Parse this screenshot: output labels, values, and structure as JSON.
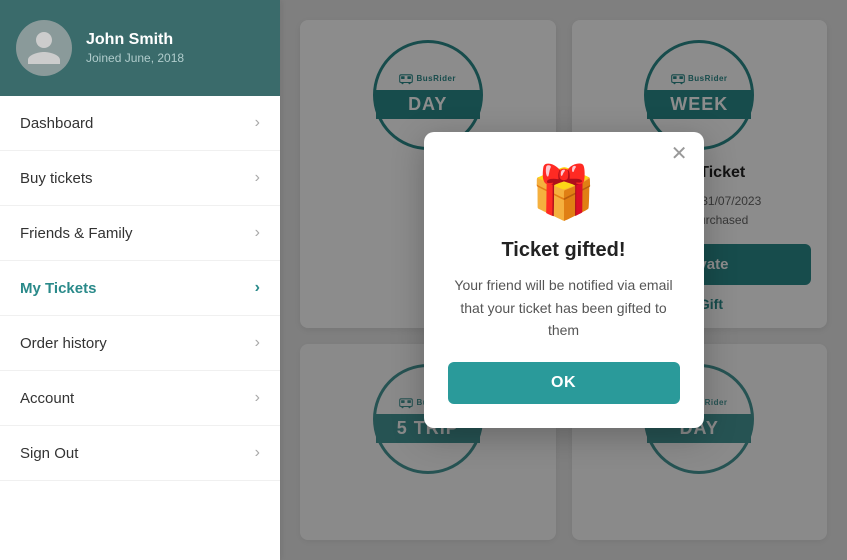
{
  "sidebar": {
    "user": {
      "name": "John Smith",
      "joined": "Joined June, 2018"
    },
    "nav_items": [
      {
        "label": "Dashboard",
        "active": false
      },
      {
        "label": "Buy tickets",
        "active": false
      },
      {
        "label": "Friends & Family",
        "active": false
      },
      {
        "label": "My Tickets",
        "active": true
      },
      {
        "label": "Order history",
        "active": false
      },
      {
        "label": "Account",
        "active": false
      },
      {
        "label": "Sign Out",
        "active": false
      }
    ]
  },
  "tickets": [
    {
      "id": "day-1",
      "type": "DAY",
      "title": "",
      "purchased": "",
      "status": ""
    },
    {
      "id": "week-1",
      "type": "WEEK",
      "title": "Week Ticket",
      "purchased": "Purchased: 31/07/2023",
      "status": "Status: Purchased",
      "activate_label": "Activate",
      "gift_label": "Gift"
    },
    {
      "id": "5trip-1",
      "type": "5 TRIP",
      "title": "",
      "purchased": "",
      "status": ""
    },
    {
      "id": "day-2",
      "type": "DAY",
      "title": "",
      "purchased": "",
      "status": ""
    }
  ],
  "modal": {
    "title": "Ticket gifted!",
    "body": "Your friend will be notified via email that your ticket has been gifted to them",
    "ok_label": "OK",
    "icon": "🎁"
  },
  "brand": {
    "name": "BusRider"
  },
  "colors": {
    "teal": "#2a8a8a",
    "teal_btn": "#2a9a9a"
  }
}
